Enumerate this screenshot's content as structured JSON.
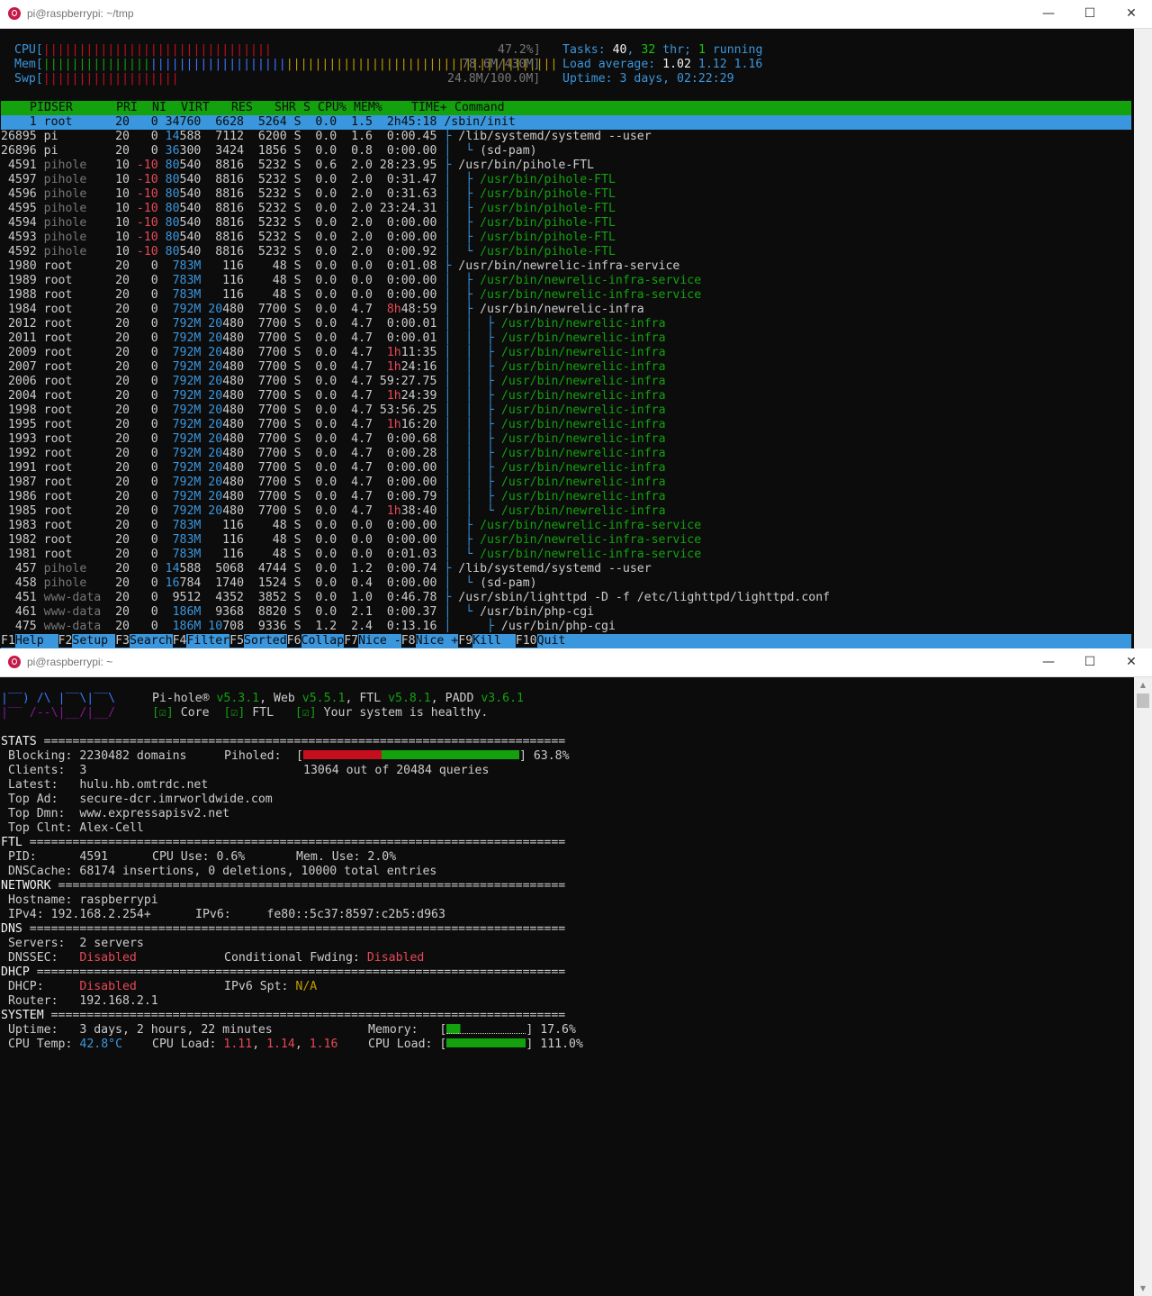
{
  "htop_window": {
    "title": "pi@raspberrypi: ~/tmp",
    "meters": {
      "cpu_label": "CPU[",
      "cpu_bar": "||||||||||||||||||||||||||||||||",
      "cpu_value": "47.2%]",
      "mem_label": "Mem[",
      "mem_bar_green": "|||||||||||||||",
      "mem_bar_blue": "|||||||||||||||||||",
      "mem_bar_yellow": "||||||||||||||||||||||||||||||||||||||",
      "mem_value": "78.6M/430M]",
      "swp_label": "Swp[",
      "swp_bar": "|||||||||||||||||||",
      "swp_value": "24.8M/100.0M]",
      "tasks_label": "Tasks:",
      "tasks": "40",
      "thr": "32",
      "thr_label": "thr;",
      "running": "1",
      "running_label": "running",
      "load_label": "Load average:",
      "load1": "1.02",
      "load5": "1.12",
      "load15": "1.16",
      "uptime_label": "Uptime:",
      "uptime": "3 days, 02:22:29"
    },
    "columns": [
      "PID",
      "USER",
      "PRI",
      "NI",
      "VIRT",
      "RES",
      "SHR",
      "S",
      "CPU%",
      "MEM%",
      "TIME+",
      "Command"
    ],
    "processes": [
      {
        "pid": "1",
        "user": "root",
        "pri": "20",
        "ni": "0",
        "virt": "34760",
        "res": "6628",
        "shr": "5264",
        "s": "S",
        "cpu": "0.0",
        "mem": "1.5",
        "time": "2h45:18",
        "tree": "",
        "cmd": "/sbin/init",
        "selected": true
      },
      {
        "pid": "26895",
        "user": "pi",
        "pri": "20",
        "ni": "0",
        "virt": "14588",
        "res": "7112",
        "shr": "6200",
        "s": "S",
        "cpu": "0.0",
        "mem": "1.6",
        "time": "0:00.45",
        "tree": "├ ",
        "cmd": "/lib/systemd/systemd --user"
      },
      {
        "pid": "26896",
        "user": "pi",
        "pri": "20",
        "ni": "0",
        "virt": "36300",
        "res": "3424",
        "shr": "1856",
        "s": "S",
        "cpu": "0.0",
        "mem": "0.8",
        "time": "0:00.00",
        "tree": "│  └ ",
        "cmd": "(sd-pam)"
      },
      {
        "pid": "4591",
        "user": "pihole",
        "pri": "10",
        "ni": "-10",
        "virt": "80540",
        "res": "8816",
        "shr": "5232",
        "s": "S",
        "cpu": "0.6",
        "mem": "2.0",
        "time": "28:23.95",
        "tree": "├ ",
        "cmd": "/usr/bin/pihole-FTL"
      },
      {
        "pid": "4597",
        "user": "pihole",
        "pri": "10",
        "ni": "-10",
        "virt": "80540",
        "res": "8816",
        "shr": "5232",
        "s": "S",
        "cpu": "0.0",
        "mem": "2.0",
        "time": "0:31.47",
        "tree": "│  ├ ",
        "cmd": "/usr/bin/pihole-FTL",
        "thread": true
      },
      {
        "pid": "4596",
        "user": "pihole",
        "pri": "10",
        "ni": "-10",
        "virt": "80540",
        "res": "8816",
        "shr": "5232",
        "s": "S",
        "cpu": "0.0",
        "mem": "2.0",
        "time": "0:31.63",
        "tree": "│  ├ ",
        "cmd": "/usr/bin/pihole-FTL",
        "thread": true
      },
      {
        "pid": "4595",
        "user": "pihole",
        "pri": "10",
        "ni": "-10",
        "virt": "80540",
        "res": "8816",
        "shr": "5232",
        "s": "S",
        "cpu": "0.0",
        "mem": "2.0",
        "time": "23:24.31",
        "tree": "│  ├ ",
        "cmd": "/usr/bin/pihole-FTL",
        "thread": true
      },
      {
        "pid": "4594",
        "user": "pihole",
        "pri": "10",
        "ni": "-10",
        "virt": "80540",
        "res": "8816",
        "shr": "5232",
        "s": "S",
        "cpu": "0.0",
        "mem": "2.0",
        "time": "0:00.00",
        "tree": "│  ├ ",
        "cmd": "/usr/bin/pihole-FTL",
        "thread": true
      },
      {
        "pid": "4593",
        "user": "pihole",
        "pri": "10",
        "ni": "-10",
        "virt": "80540",
        "res": "8816",
        "shr": "5232",
        "s": "S",
        "cpu": "0.0",
        "mem": "2.0",
        "time": "0:00.00",
        "tree": "│  ├ ",
        "cmd": "/usr/bin/pihole-FTL",
        "thread": true
      },
      {
        "pid": "4592",
        "user": "pihole",
        "pri": "10",
        "ni": "-10",
        "virt": "80540",
        "res": "8816",
        "shr": "5232",
        "s": "S",
        "cpu": "0.0",
        "mem": "2.0",
        "time": "0:00.92",
        "tree": "│  └ ",
        "cmd": "/usr/bin/pihole-FTL",
        "thread": true
      },
      {
        "pid": "1980",
        "user": "root",
        "pri": "20",
        "ni": "0",
        "virt": "783M",
        "res": "116",
        "shr": "48",
        "s": "S",
        "cpu": "0.0",
        "mem": "0.0",
        "time": "0:01.08",
        "tree": "├ ",
        "cmd": "/usr/bin/newrelic-infra-service"
      },
      {
        "pid": "1989",
        "user": "root",
        "pri": "20",
        "ni": "0",
        "virt": "783M",
        "res": "116",
        "shr": "48",
        "s": "S",
        "cpu": "0.0",
        "mem": "0.0",
        "time": "0:00.00",
        "tree": "│  ├ ",
        "cmd": "/usr/bin/newrelic-infra-service",
        "thread": true
      },
      {
        "pid": "1988",
        "user": "root",
        "pri": "20",
        "ni": "0",
        "virt": "783M",
        "res": "116",
        "shr": "48",
        "s": "S",
        "cpu": "0.0",
        "mem": "0.0",
        "time": "0:00.00",
        "tree": "│  ├ ",
        "cmd": "/usr/bin/newrelic-infra-service",
        "thread": true
      },
      {
        "pid": "1984",
        "user": "root",
        "pri": "20",
        "ni": "0",
        "virt": "792M",
        "res": "20480",
        "shr": "7700",
        "s": "S",
        "cpu": "0.0",
        "mem": "4.7",
        "time": "8h48:59",
        "tree": "│  ├ ",
        "cmd": "/usr/bin/newrelic-infra"
      },
      {
        "pid": "2012",
        "user": "root",
        "pri": "20",
        "ni": "0",
        "virt": "792M",
        "res": "20480",
        "shr": "7700",
        "s": "S",
        "cpu": "0.0",
        "mem": "4.7",
        "time": "0:00.01",
        "tree": "│  │  ├ ",
        "cmd": "/usr/bin/newrelic-infra",
        "thread": true
      },
      {
        "pid": "2011",
        "user": "root",
        "pri": "20",
        "ni": "0",
        "virt": "792M",
        "res": "20480",
        "shr": "7700",
        "s": "S",
        "cpu": "0.0",
        "mem": "4.7",
        "time": "0:00.01",
        "tree": "│  │  ├ ",
        "cmd": "/usr/bin/newrelic-infra",
        "thread": true
      },
      {
        "pid": "2009",
        "user": "root",
        "pri": "20",
        "ni": "0",
        "virt": "792M",
        "res": "20480",
        "shr": "7700",
        "s": "S",
        "cpu": "0.0",
        "mem": "4.7",
        "time": "1h11:35",
        "tree": "│  │  ├ ",
        "cmd": "/usr/bin/newrelic-infra",
        "thread": true
      },
      {
        "pid": "2007",
        "user": "root",
        "pri": "20",
        "ni": "0",
        "virt": "792M",
        "res": "20480",
        "shr": "7700",
        "s": "S",
        "cpu": "0.0",
        "mem": "4.7",
        "time": "1h24:16",
        "tree": "│  │  ├ ",
        "cmd": "/usr/bin/newrelic-infra",
        "thread": true
      },
      {
        "pid": "2006",
        "user": "root",
        "pri": "20",
        "ni": "0",
        "virt": "792M",
        "res": "20480",
        "shr": "7700",
        "s": "S",
        "cpu": "0.0",
        "mem": "4.7",
        "time": "59:27.75",
        "tree": "│  │  ├ ",
        "cmd": "/usr/bin/newrelic-infra",
        "thread": true
      },
      {
        "pid": "2004",
        "user": "root",
        "pri": "20",
        "ni": "0",
        "virt": "792M",
        "res": "20480",
        "shr": "7700",
        "s": "S",
        "cpu": "0.0",
        "mem": "4.7",
        "time": "1h24:39",
        "tree": "│  │  ├ ",
        "cmd": "/usr/bin/newrelic-infra",
        "thread": true
      },
      {
        "pid": "1998",
        "user": "root",
        "pri": "20",
        "ni": "0",
        "virt": "792M",
        "res": "20480",
        "shr": "7700",
        "s": "S",
        "cpu": "0.0",
        "mem": "4.7",
        "time": "53:56.25",
        "tree": "│  │  ├ ",
        "cmd": "/usr/bin/newrelic-infra",
        "thread": true
      },
      {
        "pid": "1995",
        "user": "root",
        "pri": "20",
        "ni": "0",
        "virt": "792M",
        "res": "20480",
        "shr": "7700",
        "s": "S",
        "cpu": "0.0",
        "mem": "4.7",
        "time": "1h16:20",
        "tree": "│  │  ├ ",
        "cmd": "/usr/bin/newrelic-infra",
        "thread": true
      },
      {
        "pid": "1993",
        "user": "root",
        "pri": "20",
        "ni": "0",
        "virt": "792M",
        "res": "20480",
        "shr": "7700",
        "s": "S",
        "cpu": "0.0",
        "mem": "4.7",
        "time": "0:00.68",
        "tree": "│  │  ├ ",
        "cmd": "/usr/bin/newrelic-infra",
        "thread": true
      },
      {
        "pid": "1992",
        "user": "root",
        "pri": "20",
        "ni": "0",
        "virt": "792M",
        "res": "20480",
        "shr": "7700",
        "s": "S",
        "cpu": "0.0",
        "mem": "4.7",
        "time": "0:00.28",
        "tree": "│  │  ├ ",
        "cmd": "/usr/bin/newrelic-infra",
        "thread": true
      },
      {
        "pid": "1991",
        "user": "root",
        "pri": "20",
        "ni": "0",
        "virt": "792M",
        "res": "20480",
        "shr": "7700",
        "s": "S",
        "cpu": "0.0",
        "mem": "4.7",
        "time": "0:00.00",
        "tree": "│  │  ├ ",
        "cmd": "/usr/bin/newrelic-infra",
        "thread": true
      },
      {
        "pid": "1987",
        "user": "root",
        "pri": "20",
        "ni": "0",
        "virt": "792M",
        "res": "20480",
        "shr": "7700",
        "s": "S",
        "cpu": "0.0",
        "mem": "4.7",
        "time": "0:00.00",
        "tree": "│  │  ├ ",
        "cmd": "/usr/bin/newrelic-infra",
        "thread": true
      },
      {
        "pid": "1986",
        "user": "root",
        "pri": "20",
        "ni": "0",
        "virt": "792M",
        "res": "20480",
        "shr": "7700",
        "s": "S",
        "cpu": "0.0",
        "mem": "4.7",
        "time": "0:00.79",
        "tree": "│  │  ├ ",
        "cmd": "/usr/bin/newrelic-infra",
        "thread": true
      },
      {
        "pid": "1985",
        "user": "root",
        "pri": "20",
        "ni": "0",
        "virt": "792M",
        "res": "20480",
        "shr": "7700",
        "s": "S",
        "cpu": "0.0",
        "mem": "4.7",
        "time": "1h38:40",
        "tree": "│  │  └ ",
        "cmd": "/usr/bin/newrelic-infra",
        "thread": true
      },
      {
        "pid": "1983",
        "user": "root",
        "pri": "20",
        "ni": "0",
        "virt": "783M",
        "res": "116",
        "shr": "48",
        "s": "S",
        "cpu": "0.0",
        "mem": "0.0",
        "time": "0:00.00",
        "tree": "│  ├ ",
        "cmd": "/usr/bin/newrelic-infra-service",
        "thread": true
      },
      {
        "pid": "1982",
        "user": "root",
        "pri": "20",
        "ni": "0",
        "virt": "783M",
        "res": "116",
        "shr": "48",
        "s": "S",
        "cpu": "0.0",
        "mem": "0.0",
        "time": "0:00.00",
        "tree": "│  ├ ",
        "cmd": "/usr/bin/newrelic-infra-service",
        "thread": true
      },
      {
        "pid": "1981",
        "user": "root",
        "pri": "20",
        "ni": "0",
        "virt": "783M",
        "res": "116",
        "shr": "48",
        "s": "S",
        "cpu": "0.0",
        "mem": "0.0",
        "time": "0:01.03",
        "tree": "│  └ ",
        "cmd": "/usr/bin/newrelic-infra-service",
        "thread": true
      },
      {
        "pid": "457",
        "user": "pihole",
        "pri": "20",
        "ni": "0",
        "virt": "14588",
        "res": "5068",
        "shr": "4744",
        "s": "S",
        "cpu": "0.0",
        "mem": "1.2",
        "time": "0:00.74",
        "tree": "├ ",
        "cmd": "/lib/systemd/systemd --user"
      },
      {
        "pid": "458",
        "user": "pihole",
        "pri": "20",
        "ni": "0",
        "virt": "16784",
        "res": "1740",
        "shr": "1524",
        "s": "S",
        "cpu": "0.0",
        "mem": "0.4",
        "time": "0:00.00",
        "tree": "│  └ ",
        "cmd": "(sd-pam)"
      },
      {
        "pid": "451",
        "user": "www-data",
        "pri": "20",
        "ni": "0",
        "virt": "9512",
        "res": "4352",
        "shr": "3852",
        "s": "S",
        "cpu": "0.0",
        "mem": "1.0",
        "time": "0:46.78",
        "tree": "├ ",
        "cmd": "/usr/sbin/lighttpd -D -f /etc/lighttpd/lighttpd.conf"
      },
      {
        "pid": "461",
        "user": "www-data",
        "pri": "20",
        "ni": "0",
        "virt": "186M",
        "res": "9368",
        "shr": "8820",
        "s": "S",
        "cpu": "0.0",
        "mem": "2.1",
        "time": "0:00.37",
        "tree": "│  └ ",
        "cmd": "/usr/bin/php-cgi"
      },
      {
        "pid": "475",
        "user": "www-data",
        "pri": "20",
        "ni": "0",
        "virt": "186M",
        "res": "10708",
        "shr": "9336",
        "s": "S",
        "cpu": "1.2",
        "mem": "2.4",
        "time": "0:13.16",
        "tree": "│     ├ ",
        "cmd": "/usr/bin/php-cgi"
      }
    ],
    "function_keys": [
      {
        "key": "F1",
        "label": "Help  "
      },
      {
        "key": "F2",
        "label": "Setup "
      },
      {
        "key": "F3",
        "label": "Search"
      },
      {
        "key": "F4",
        "label": "Filter"
      },
      {
        "key": "F5",
        "label": "Sorted"
      },
      {
        "key": "F6",
        "label": "Collap"
      },
      {
        "key": "F7",
        "label": "Nice -"
      },
      {
        "key": "F8",
        "label": "Nice +"
      },
      {
        "key": "F9",
        "label": "Kill  "
      },
      {
        "key": "F10",
        "label": "Quit"
      }
    ]
  },
  "padd_window": {
    "title": "pi@raspberrypi: ~",
    "logo_line1": "|‾‾) /\\ |‾‾\\|‾‾\\",
    "logo_line2": "|‾‾ /--\\|__/|__/",
    "versions": {
      "pihole_label": "Pi-hole®",
      "pihole": "v5.3.1",
      "web_label": "Web",
      "web": "v5.5.1",
      "ftl_label": "FTL",
      "ftl": "v5.8.1",
      "padd_label": "PADD",
      "padd": "v3.6.1"
    },
    "status": {
      "core": "Core",
      "ftl": "FTL",
      "message": "Your system is healthy.",
      "check": "[☑]"
    },
    "stats": {
      "heading": "STATS",
      "blocking_label": "Blocking:",
      "blocking": "2230482 domains",
      "piholed_label": "Piholed:",
      "piholed_percent": "63.8%",
      "piholed_fraction": 0.638,
      "clients_label": "Clients:",
      "clients": "3",
      "queries": "13064 out of 20484 queries",
      "latest_label": "Latest:",
      "latest": "hulu.hb.omtrdc.net",
      "top_ad_label": "Top Ad:",
      "top_ad": "secure-dcr.imrworldwide.com",
      "top_dmn_label": "Top Dmn:",
      "top_dmn": "www.expressapisv2.net",
      "top_clnt_label": "Top Clnt:",
      "top_clnt": "Alex-Cell"
    },
    "ftl": {
      "heading": "FTL",
      "pid_label": "PID:",
      "pid": "4591",
      "cpu_label": "CPU Use:",
      "cpu": "0.6%",
      "mem_label": "Mem. Use:",
      "mem": "2.0%",
      "dnscache_label": "DNSCache:",
      "dnscache": "68174 insertions, 0 deletions, 10000 total entries"
    },
    "network": {
      "heading": "NETWORK",
      "hostname_label": "Hostname:",
      "hostname": "raspberrypi",
      "ipv4_label": "IPv4:",
      "ipv4": "192.168.2.254+",
      "ipv6_label": "IPv6:",
      "ipv6": "fe80::5c37:8597:c2b5:d963"
    },
    "dns": {
      "heading": "DNS",
      "servers_label": "Servers:",
      "servers": "2 servers",
      "dnssec_label": "DNSSEC:",
      "dnssec": "Disabled",
      "cond_label": "Conditional Fwding:",
      "cond": "Disabled"
    },
    "dhcp": {
      "heading": "DHCP",
      "dhcp_label": "DHCP:",
      "dhcp": "Disabled",
      "ipv6spt_label": "IPv6 Spt:",
      "ipv6spt": "N/A",
      "router_label": "Router:",
      "router": "192.168.2.1"
    },
    "system": {
      "heading": "SYSTEM",
      "uptime_label": "Uptime:",
      "uptime": "3 days, 2 hours, 22 minutes",
      "memory_label": "Memory:",
      "memory": "17.6%",
      "memory_fraction": 0.176,
      "cputemp_label": "CPU Temp:",
      "cputemp": "42.8°C",
      "cpuload_label": "CPU Load:",
      "load1": "1.11",
      "load5": "1.14",
      "load15": "1.16",
      "cpuload2_label": "CPU Load:",
      "cpuload_pct": "111.0%",
      "cpuload_fraction": 1.0
    }
  },
  "colors": {
    "green": "#13a10e",
    "red": "#c50f1f",
    "blue": "#3b78ff",
    "cyan": "#3a96dd",
    "yellow": "#c19c00",
    "gray": "#767676",
    "fg": "#cccccc",
    "bg": "#0c0c0c"
  }
}
